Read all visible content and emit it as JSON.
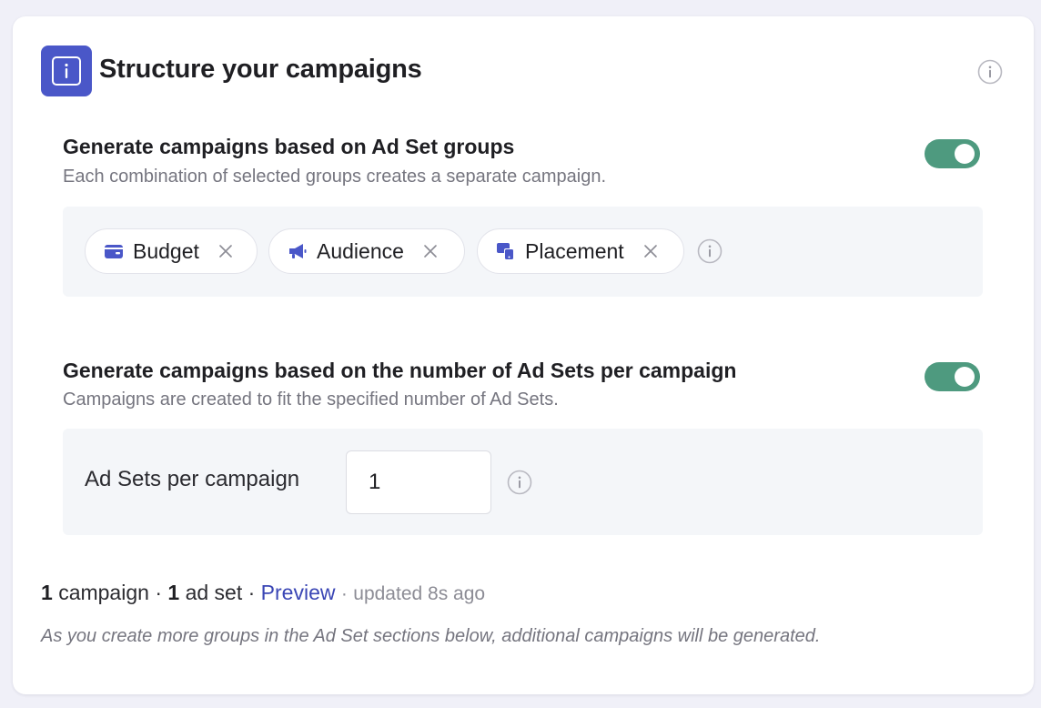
{
  "header": {
    "title": "Structure your campaigns",
    "icon": "info-box-icon",
    "accent_color": "#4a57c8"
  },
  "section_groups": {
    "title": "Generate campaigns based on Ad Set groups",
    "description": "Each combination of selected groups creates a separate campaign.",
    "toggle_on": true,
    "chips": [
      {
        "label": "Budget",
        "icon": "wallet-icon"
      },
      {
        "label": "Audience",
        "icon": "megaphone-icon"
      },
      {
        "label": "Placement",
        "icon": "placement-icon"
      }
    ]
  },
  "section_count": {
    "title": "Generate campaigns based on the number of Ad Sets per campaign",
    "description": "Campaigns are created to fit the specified number of Ad Sets.",
    "toggle_on": true,
    "field_label": "Ad Sets per campaign",
    "field_value": "1"
  },
  "summary": {
    "campaign_count": "1",
    "campaign_word": "campaign",
    "separator": "·",
    "adset_count": "1",
    "adset_word": "ad set",
    "preview_link": "Preview",
    "updated": "updated 8s ago"
  },
  "note": "As you create more groups in the Ad Set sections below, additional campaigns will be generated.",
  "colors": {
    "toggle": "#4e9a7f",
    "link": "#3a46b5",
    "chip_icon": "#4a57c8",
    "panel_bg": "#f4f6f9"
  }
}
